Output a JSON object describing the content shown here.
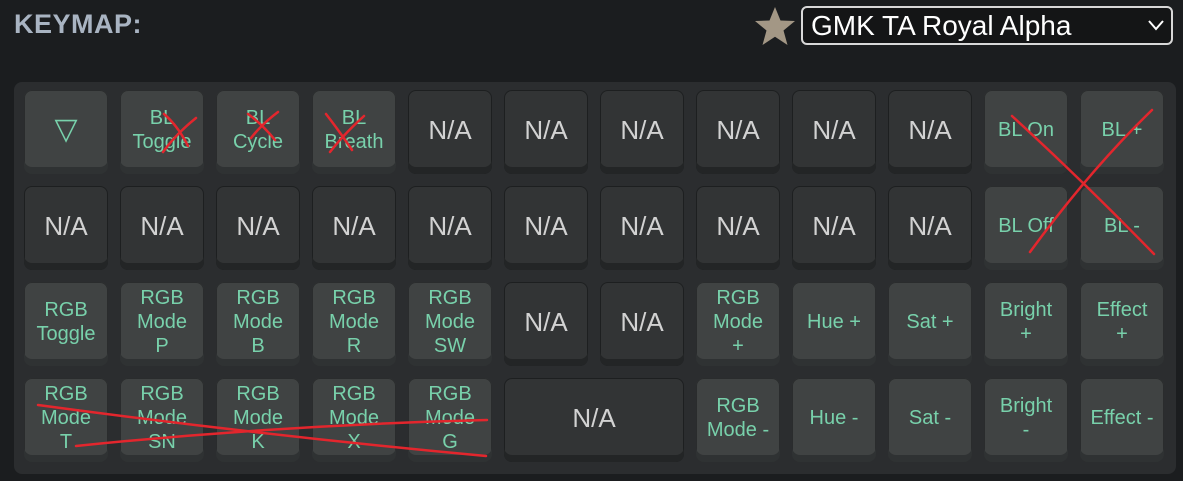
{
  "header": {
    "title": "KEYMAP:",
    "favorite_icon": "star-icon",
    "keycap_set": "GMK TA Royal Alpha"
  },
  "keymap": {
    "rows": [
      [
        {
          "label": "▽",
          "style": "alpha",
          "name": "transparent-key"
        },
        {
          "label": "BL\nToggle",
          "style": "alpha"
        },
        {
          "label": "BL\nCycle",
          "style": "alpha"
        },
        {
          "label": "BL\nBreath",
          "style": "alpha"
        },
        {
          "label": "N/A",
          "style": "mod"
        },
        {
          "label": "N/A",
          "style": "mod"
        },
        {
          "label": "N/A",
          "style": "mod"
        },
        {
          "label": "N/A",
          "style": "mod"
        },
        {
          "label": "N/A",
          "style": "mod"
        },
        {
          "label": "N/A",
          "style": "mod"
        },
        {
          "label": "BL On",
          "style": "alpha"
        },
        {
          "label": "BL +",
          "style": "alpha"
        }
      ],
      [
        {
          "label": "N/A",
          "style": "mod"
        },
        {
          "label": "N/A",
          "style": "mod"
        },
        {
          "label": "N/A",
          "style": "mod"
        },
        {
          "label": "N/A",
          "style": "mod"
        },
        {
          "label": "N/A",
          "style": "mod"
        },
        {
          "label": "N/A",
          "style": "mod"
        },
        {
          "label": "N/A",
          "style": "mod"
        },
        {
          "label": "N/A",
          "style": "mod"
        },
        {
          "label": "N/A",
          "style": "mod"
        },
        {
          "label": "N/A",
          "style": "mod"
        },
        {
          "label": "BL Off",
          "style": "alpha"
        },
        {
          "label": "BL -",
          "style": "alpha"
        }
      ],
      [
        {
          "label": "RGB\nToggle",
          "style": "alpha"
        },
        {
          "label": "RGB\nMode\nP",
          "style": "alpha"
        },
        {
          "label": "RGB\nMode\nB",
          "style": "alpha"
        },
        {
          "label": "RGB\nMode\nR",
          "style": "alpha"
        },
        {
          "label": "RGB\nMode\nSW",
          "style": "alpha"
        },
        {
          "label": "N/A",
          "style": "mod"
        },
        {
          "label": "N/A",
          "style": "mod"
        },
        {
          "label": "RGB\nMode\n+",
          "style": "alpha"
        },
        {
          "label": "Hue +",
          "style": "alpha"
        },
        {
          "label": "Sat +",
          "style": "alpha"
        },
        {
          "label": "Bright\n+",
          "style": "alpha"
        },
        {
          "label": "Effect\n+",
          "style": "alpha"
        }
      ],
      [
        {
          "label": "RGB\nMode\nT",
          "style": "alpha"
        },
        {
          "label": "RGB\nMode\nSN",
          "style": "alpha"
        },
        {
          "label": "RGB\nMode\nK",
          "style": "alpha"
        },
        {
          "label": "RGB\nMode\nX",
          "style": "alpha"
        },
        {
          "label": "RGB\nMode\nG",
          "style": "alpha"
        },
        {
          "label": "N/A",
          "style": "mod",
          "span": 2
        },
        {
          "label": "RGB\nMode -",
          "style": "alpha"
        },
        {
          "label": "Hue -",
          "style": "alpha"
        },
        {
          "label": "Sat -",
          "style": "alpha"
        },
        {
          "label": "Bright\n-",
          "style": "alpha"
        },
        {
          "label": "Effect -",
          "style": "alpha"
        }
      ]
    ]
  },
  "annotations": {
    "color": "#e3262d",
    "description_icons": [
      "cross-mark-bl-toggle",
      "cross-mark-bl-cycle",
      "cross-mark-bl-breath",
      "cross-mark-bl-cluster",
      "strike-rgb-row"
    ]
  },
  "colors": {
    "background": "#1b1d1f",
    "board": "#2b2d2f",
    "alpha_key": "#404343",
    "mod_key": "#323435",
    "legend_green": "#78d1ab",
    "legend_gray": "#d2d2d2"
  }
}
